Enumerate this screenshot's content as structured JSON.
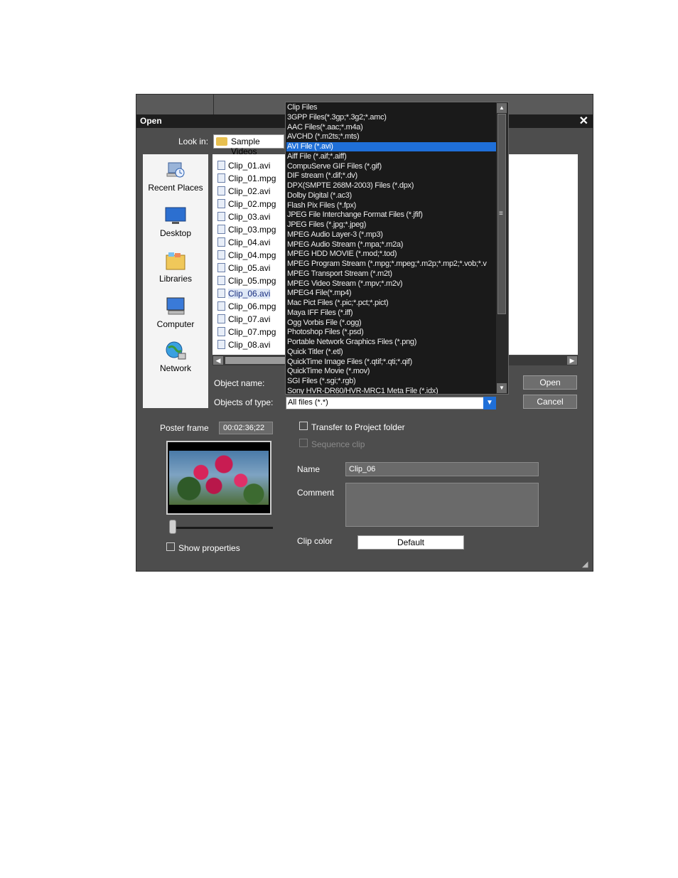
{
  "dialog": {
    "title": "Open",
    "close_glyph": "✕"
  },
  "look_in": {
    "label": "Look in:",
    "value": "Sample Videos"
  },
  "places": [
    {
      "label": "Recent Places",
      "icon": "recent-places-icon"
    },
    {
      "label": "Desktop",
      "icon": "desktop-icon"
    },
    {
      "label": "Libraries",
      "icon": "libraries-icon"
    },
    {
      "label": "Computer",
      "icon": "computer-icon"
    },
    {
      "label": "Network",
      "icon": "network-icon"
    }
  ],
  "files": [
    "Clip_01.avi",
    "Clip_01.mpg",
    "Clip_02.avi",
    "Clip_02.mpg",
    "Clip_03.avi",
    "Clip_03.mpg",
    "Clip_04.avi",
    "Clip_04.mpg",
    "Clip_05.avi",
    "Clip_05.mpg",
    "Clip_06.avi",
    "Clip_06.mpg",
    "Clip_07.avi",
    "Clip_07.mpg",
    "Clip_08.avi"
  ],
  "selected_file": "Clip_06.avi",
  "object_name_label": "Object name:",
  "objects_of_type_label": "Objects of type:",
  "objects_of_type_value": "All files (*.*)",
  "buttons": {
    "open": "Open",
    "cancel": "Cancel"
  },
  "file_types": [
    "Clip Files",
    "3GPP Files(*.3gp;*.3g2;*.amc)",
    "AAC Files(*.aac;*.m4a)",
    "AVCHD (*.m2ts;*.mts)",
    "AVI File (*.avi)",
    "Aiff File (*.aif;*.aiff)",
    "CompuServe GIF Files (*.gif)",
    "DIF stream (*.dif;*.dv)",
    "DPX(SMPTE 268M-2003) Files (*.dpx)",
    "Dolby Digital (*.ac3)",
    "Flash Pix Files (*.fpx)",
    "JPEG File Interchange Format Files (*.jfif)",
    "JPEG Files (*.jpg;*.jpeg)",
    "MPEG Audio Layer-3 (*.mp3)",
    "MPEG Audio Stream (*.mpa;*.m2a)",
    "MPEG HDD MOVIE (*.mod;*.tod)",
    "MPEG Program Stream (*.mpg;*.mpeg;*.m2p;*.mp2;*.vob;*.v",
    "MPEG Transport Stream (*.m2t)",
    "MPEG Video Stream (*.mpv;*.m2v)",
    "MPEG4 File(*.mp4)",
    "Mac Pict Files (*.pic;*.pct;*.pict)",
    "Maya IFF Files (*.iff)",
    "Ogg Vorbis File (*.ogg)",
    "Photoshop Files (*.psd)",
    "Portable Network Graphics Files (*.png)",
    "Quick Titler (*.etl)",
    "QuickTime Image Files (*.qtif;*.qti;*.qif)",
    "QuickTime Movie (*.mov)",
    "SGI Files (*.sgi;*.rgb)",
    "Sony HVR-DR60/HVR-MRC1 Meta File (*.idx)"
  ],
  "selected_file_type": "AVI File (*.avi)",
  "poster_frame": {
    "label": "Poster frame",
    "timecode": "00:02:36;22"
  },
  "options": {
    "transfer_to_project_folder": "Transfer to Project folder",
    "sequence_clip": "Sequence clip",
    "show_properties": "Show properties"
  },
  "properties": {
    "name_label": "Name",
    "name_value": "Clip_06",
    "comment_label": "Comment",
    "comment_value": "",
    "clip_color_label": "Clip color",
    "clip_color_value": "Default"
  },
  "colors": {
    "dialog_bg": "#4d4d4d",
    "titlebar_bg": "#1e1e1e",
    "selection": "#1f6fd8"
  }
}
